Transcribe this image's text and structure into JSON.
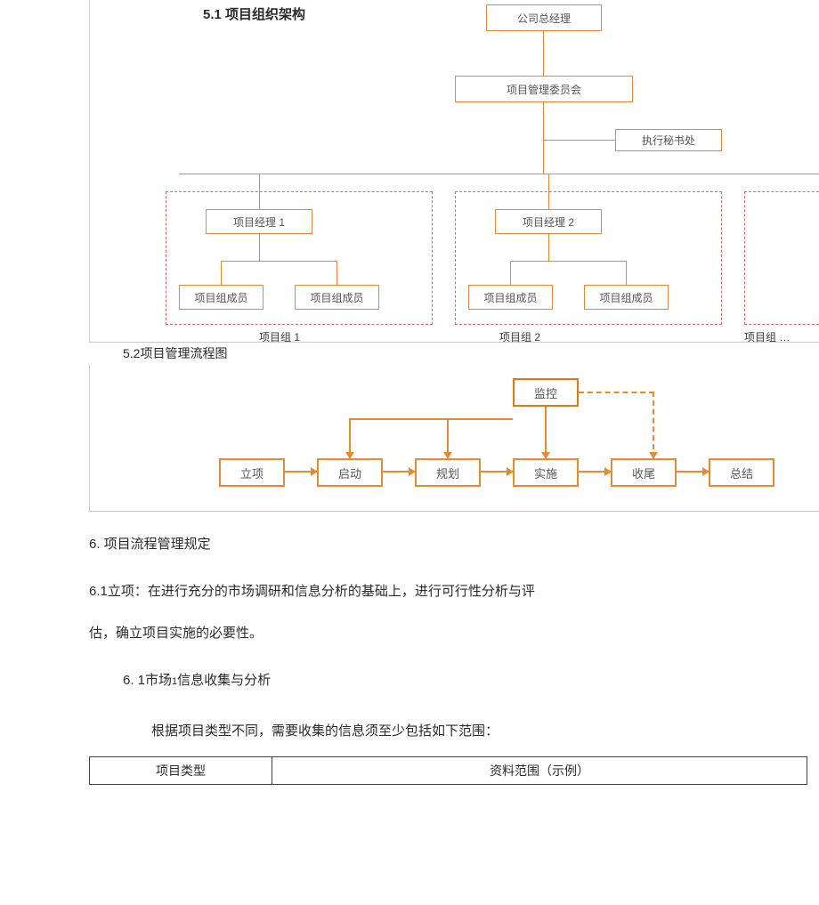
{
  "s51": {
    "heading": "5.1  项目组织架构"
  },
  "org": {
    "gm": "公司总经理",
    "pmc": "项目管理委员会",
    "sec": "执行秘书处",
    "pm1": "项目经理  1",
    "pm2": "项目经理  2",
    "member": "项目组成员",
    "ellipsis": "……",
    "group1": "项目组  1",
    "group2": "项目组  2",
    "group3": "项目组  …"
  },
  "s52": {
    "heading": "5.2项目管理流程图"
  },
  "flow": {
    "monitor": "监控",
    "b1": "立项",
    "b2": "启动",
    "b3": "规划",
    "b4": "实施",
    "b5": "收尾",
    "b6": "总结"
  },
  "s6": {
    "heading": "6.   项目流程管理规定"
  },
  "s61": {
    "p1": "6.1立项：在进行充分的市场调研和信息分析的基础上，进行可行性分析与评",
    "p2": "估，确立项目实施的必要性。"
  },
  "s611": {
    "heading_prefix": "6.    1市场",
    "heading_sub": "1",
    "heading_suffix": "信息收集与分析",
    "para": "根据项目类型不同，需要收集的信息须至少包括如下范围："
  },
  "table": {
    "h1": "项目类型",
    "h2": "资料范围（示例）"
  }
}
